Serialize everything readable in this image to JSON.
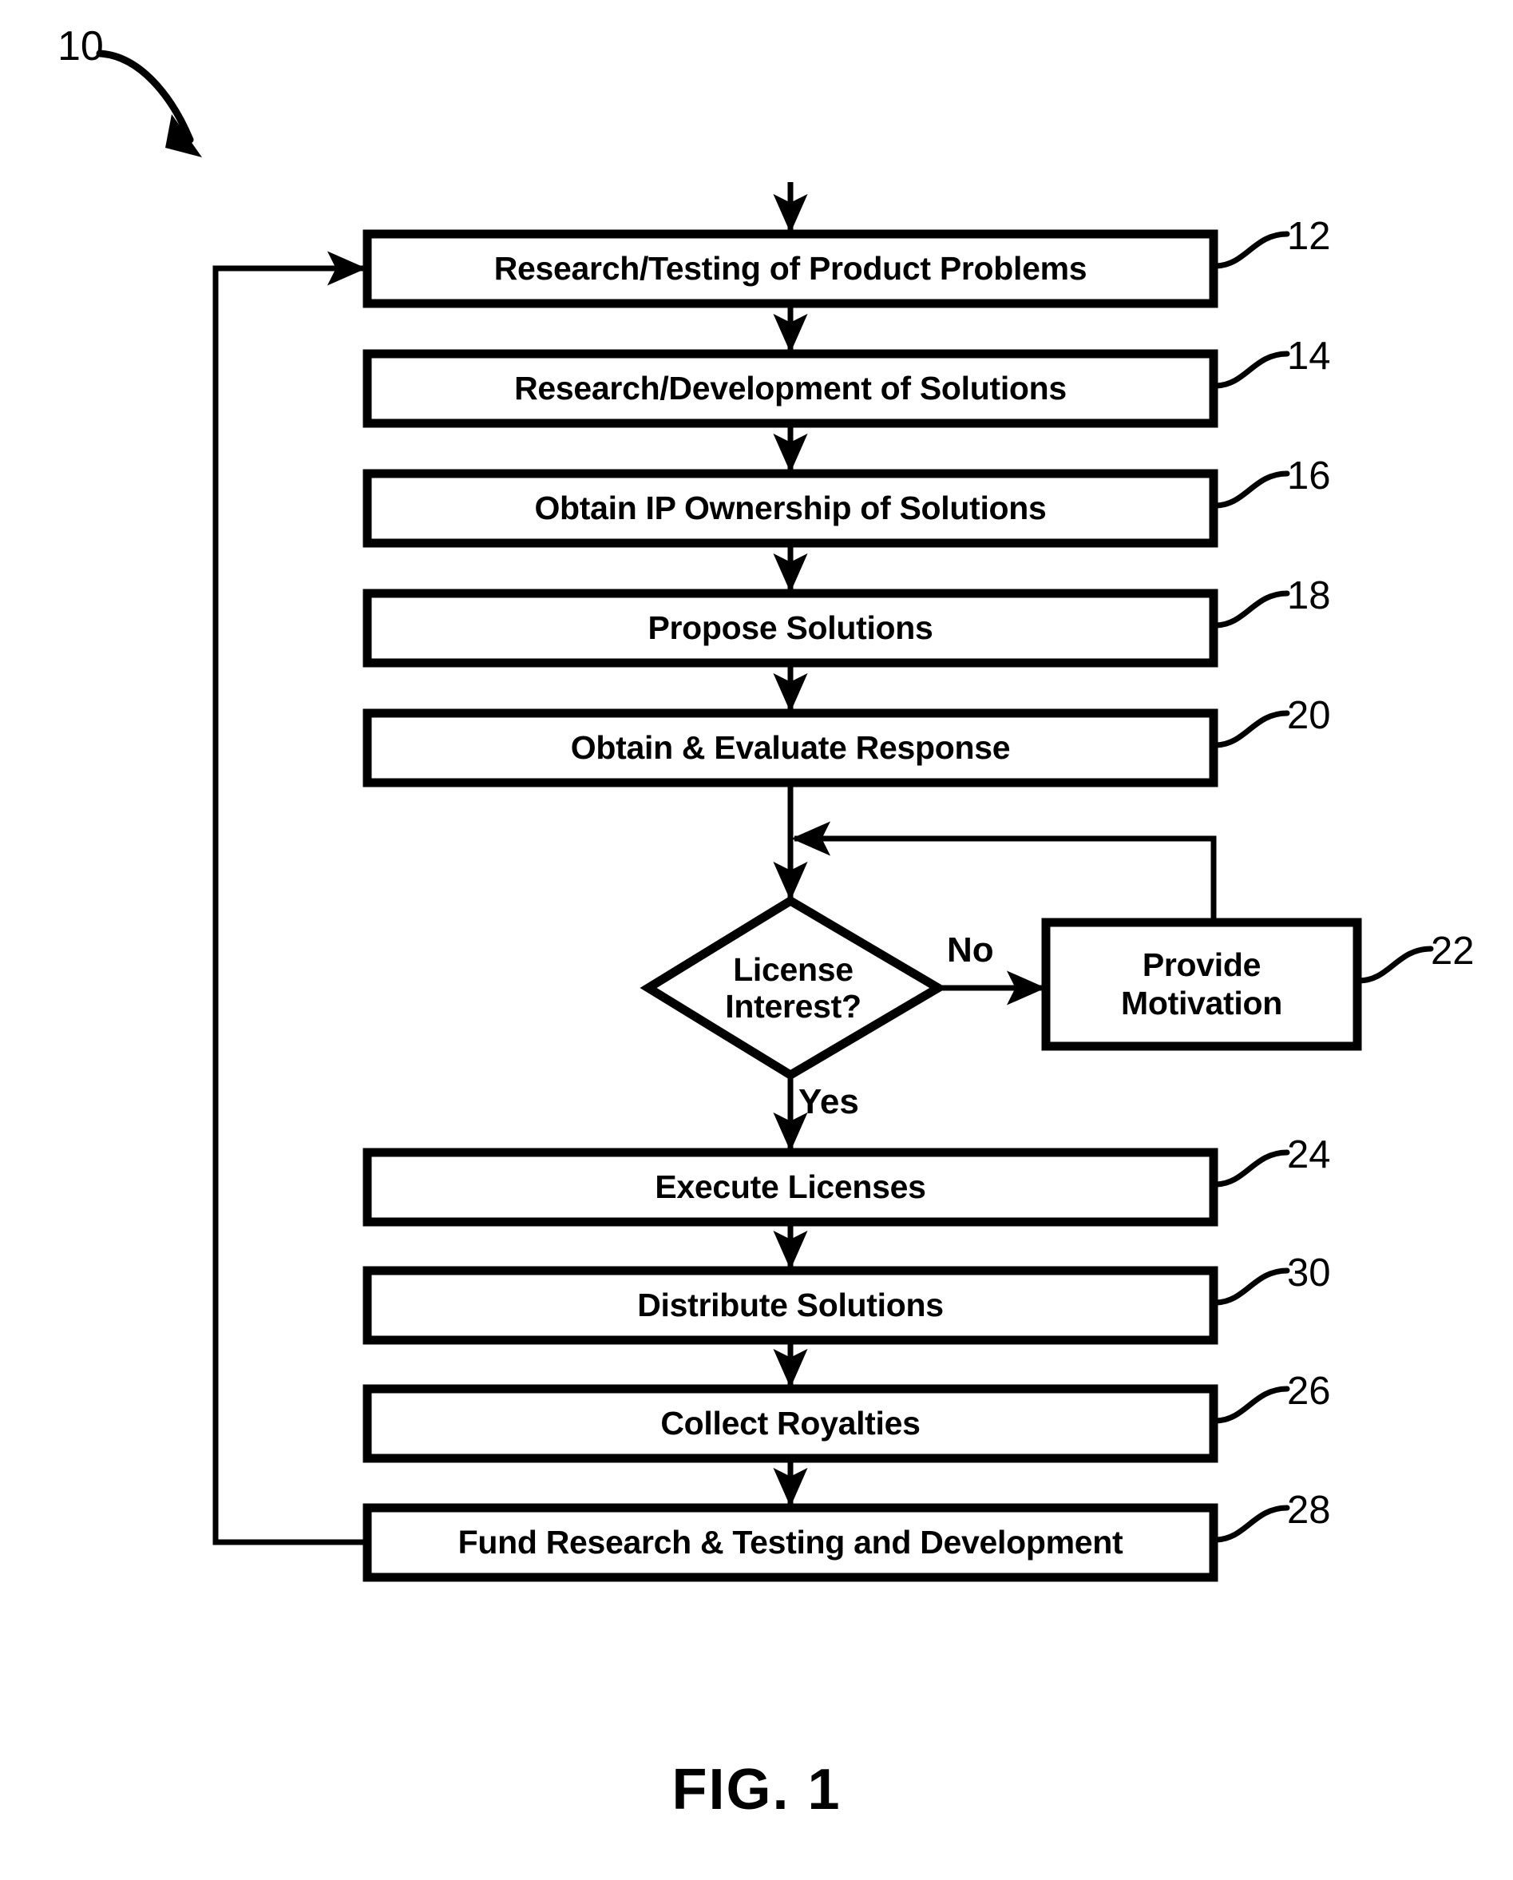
{
  "figure": {
    "caption": "FIG. 1",
    "system_number": "10"
  },
  "nodes": [
    {
      "id": "n12",
      "ref": "12",
      "label": "Research/Testing of Product Problems",
      "shape": "rect"
    },
    {
      "id": "n14",
      "ref": "14",
      "label": "Research/Development of Solutions",
      "shape": "rect"
    },
    {
      "id": "n16",
      "ref": "16",
      "label": "Obtain IP Ownership of Solutions",
      "shape": "rect"
    },
    {
      "id": "n18",
      "ref": "18",
      "label": "Propose Solutions",
      "shape": "rect"
    },
    {
      "id": "n20",
      "ref": "20",
      "label": "Obtain & Evaluate Response",
      "shape": "rect"
    },
    {
      "id": "n21",
      "ref": "",
      "label": "License\nInterest?",
      "shape": "diamond"
    },
    {
      "id": "n22",
      "ref": "22",
      "label": "Provide\nMotivation",
      "shape": "rect"
    },
    {
      "id": "n24",
      "ref": "24",
      "label": "Execute Licenses",
      "shape": "rect"
    },
    {
      "id": "n30",
      "ref": "30",
      "label": "Distribute Solutions",
      "shape": "rect"
    },
    {
      "id": "n26",
      "ref": "26",
      "label": "Collect Royalties",
      "shape": "rect"
    },
    {
      "id": "n28",
      "ref": "28",
      "label": "Fund Research & Testing and Development",
      "shape": "rect"
    }
  ],
  "edge_labels": {
    "no": "No",
    "yes": "Yes"
  },
  "colors": {
    "stroke": "#000000",
    "fill": "#ffffff",
    "text": "#000000"
  }
}
